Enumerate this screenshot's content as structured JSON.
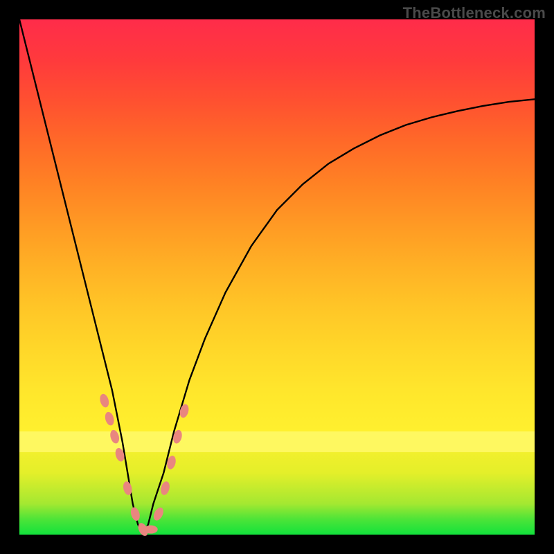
{
  "watermark": "TheBottleneck.com",
  "chart_data": {
    "type": "line",
    "title": "",
    "xlabel": "",
    "ylabel": "",
    "xlim": [
      0,
      100
    ],
    "ylim": [
      0,
      100
    ],
    "legend": false,
    "grid": false,
    "series": [
      {
        "name": "bottleneck-curve",
        "x": [
          0,
          2,
          4,
          6,
          8,
          10,
          12,
          14,
          16,
          18,
          20,
          21,
          22,
          23,
          24,
          25,
          26,
          28,
          30,
          33,
          36,
          40,
          45,
          50,
          55,
          60,
          65,
          70,
          75,
          80,
          85,
          90,
          95,
          100
        ],
        "values": [
          100,
          92,
          84,
          76,
          68,
          60,
          52,
          44,
          36,
          28,
          18,
          12,
          6,
          2,
          0,
          2,
          6,
          12,
          20,
          30,
          38,
          47,
          56,
          63,
          68,
          72,
          75,
          77.5,
          79.5,
          81,
          82.2,
          83.2,
          84,
          84.5
        ]
      }
    ],
    "markers": {
      "name": "highlight-dots",
      "color": "#e9867f",
      "x": [
        16.5,
        17.5,
        18.5,
        19.5,
        21,
        22.5,
        24,
        25.5,
        27,
        28.3,
        29.5,
        30.7,
        32
      ],
      "values": [
        26,
        22.5,
        19,
        15.5,
        9,
        4,
        1,
        1,
        4,
        9,
        14,
        19,
        24
      ]
    },
    "highlight_band_y": 18
  }
}
